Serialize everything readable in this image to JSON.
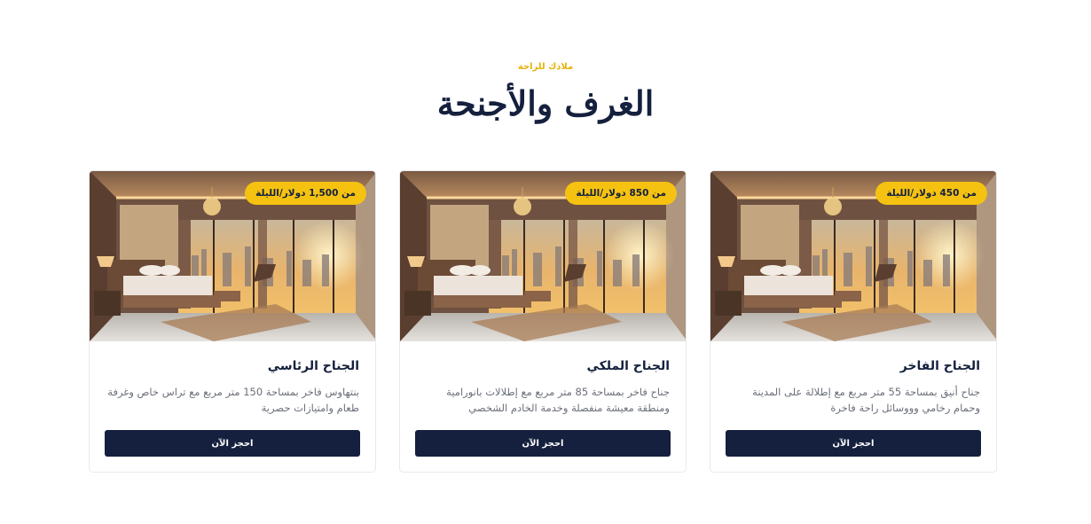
{
  "section": {
    "eyebrow": "ملاذك للراحة",
    "title": "الغرف والأجنحة"
  },
  "rooms": [
    {
      "name": "الجناح الفاخر",
      "price_badge": "من 450 دولار/الليلة",
      "description": "جناح أنيق بمساحة 55 متر مربع مع إطلالة على المدينة وحمام رخامي وووسائل راحة فاخرة",
      "button_label": "احجز الآن"
    },
    {
      "name": "الجناح الملكي",
      "price_badge": "من 850 دولار/الليلة",
      "description": "جناح فاخر بمساحة 85 متر مربع مع إطلالات بانورامية ومنطقة معيشة منفصلة وخدمة الخادم الشخصي",
      "button_label": "احجز الآن"
    },
    {
      "name": "الجناح الرئاسي",
      "price_badge": "من 1,500 دولار/الليلة",
      "description": "بنتهاوس فاخر بمساحة 150 متر مربع مع تراس خاص وغرفة طعام وامتيازات حصرية",
      "button_label": "احجز الآن"
    }
  ],
  "colors": {
    "accent": "#f5c211",
    "navy": "#14203d",
    "muted_text": "#6b6f7a"
  }
}
